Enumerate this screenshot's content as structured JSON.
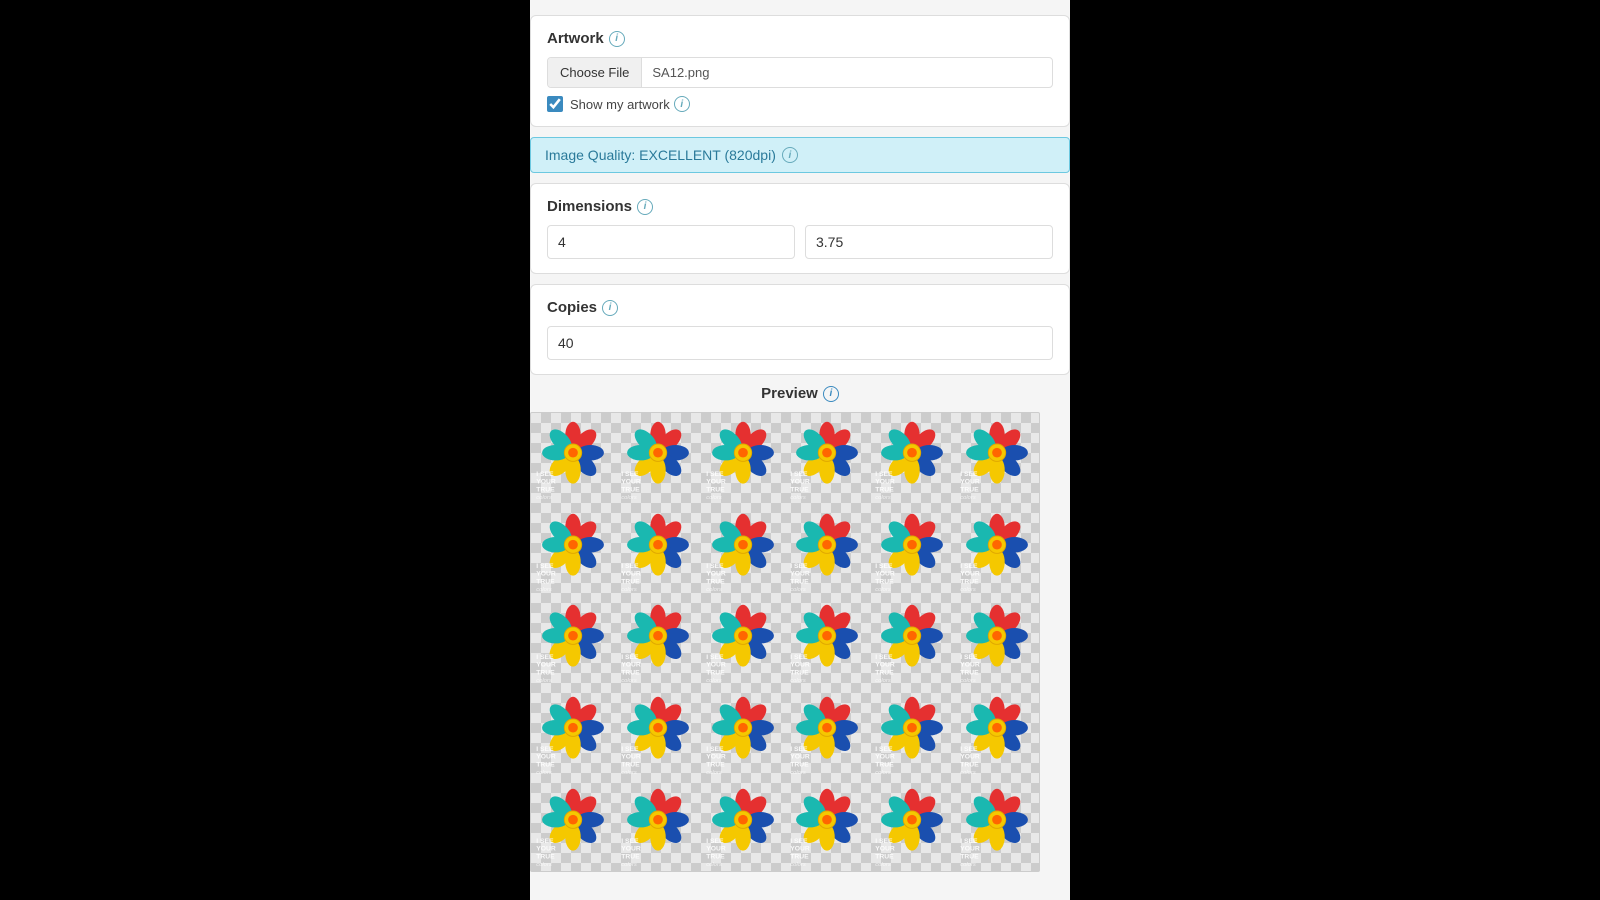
{
  "artwork": {
    "label": "Artwork",
    "info": "i",
    "choose_file_btn": "Choose File",
    "file_name": "SA12.png",
    "show_artwork_label": "Show my artwork",
    "show_artwork_checked": true
  },
  "quality": {
    "label": "Image Quality: EXCELLENT (820dpi)",
    "info": "i"
  },
  "dimensions": {
    "label": "Dimensions",
    "info": "i",
    "width": "4",
    "height": "3.75"
  },
  "copies": {
    "label": "Copies",
    "info": "i",
    "value": "40"
  },
  "preview": {
    "label": "Preview",
    "info": "i",
    "sticker_text_line1": "I SEE",
    "sticker_text_line2": "YOUR",
    "sticker_text_line3": "TRUE",
    "sticker_text_line4": "colors"
  },
  "icons": {
    "info": "i"
  }
}
